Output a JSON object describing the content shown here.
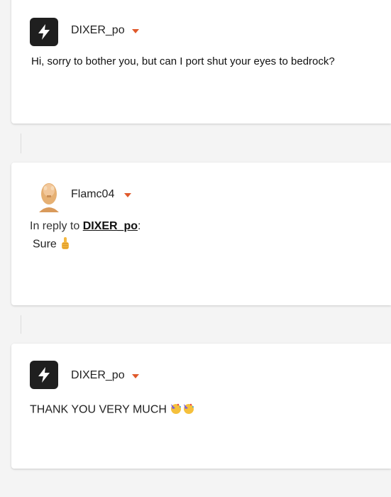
{
  "posts": [
    {
      "username": "DIXER_po",
      "message": "Hi, sorry to bother you, but can I port shut your eyes to bedrock?"
    },
    {
      "username": "Flamc04",
      "reply_prefix": "In reply to ",
      "reply_to": "DIXER_po",
      "reply_suffix": ":",
      "message": "Sure"
    },
    {
      "username": "DIXER_po",
      "message": "THANK YOU VERY MUCH"
    }
  ],
  "icons": {
    "avatar_bolt": "lightning-bolt-icon",
    "dropdown": "chevron-down-icon",
    "thumbs_up": "thumbs-up-emoji",
    "party": "party-face-emoji"
  },
  "colors": {
    "accent_caret": "#e0592b",
    "avatar_bg": "#1f1f1f"
  }
}
